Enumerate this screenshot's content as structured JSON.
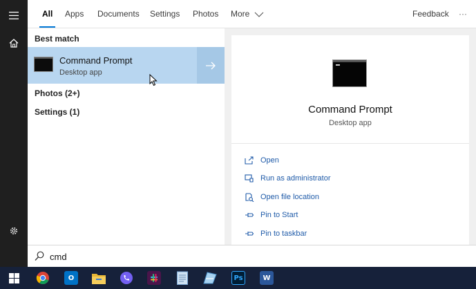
{
  "tabs": [
    {
      "label": "All",
      "active": true
    },
    {
      "label": "Apps"
    },
    {
      "label": "Documents"
    },
    {
      "label": "Settings"
    },
    {
      "label": "Photos"
    },
    {
      "label": "More"
    }
  ],
  "header": {
    "feedback": "Feedback",
    "more_dots": "···"
  },
  "results": {
    "best_match_header": "Best match",
    "best_match": {
      "title": "Command Prompt",
      "subtitle": "Desktop app"
    },
    "groups": [
      {
        "label": "Photos (2+)"
      },
      {
        "label": "Settings (1)"
      }
    ]
  },
  "preview": {
    "title": "Command Prompt",
    "subtitle": "Desktop app",
    "actions": [
      {
        "label": "Open",
        "icon": "open-icon"
      },
      {
        "label": "Run as administrator",
        "icon": "shield-icon"
      },
      {
        "label": "Open file location",
        "icon": "file-location-icon"
      },
      {
        "label": "Pin to Start",
        "icon": "pin-icon"
      },
      {
        "label": "Pin to taskbar",
        "icon": "pin-icon"
      }
    ]
  },
  "search": {
    "value": "cmd"
  },
  "taskbar": {
    "apps": [
      {
        "name": "chrome",
        "color": "#4285f4"
      },
      {
        "name": "outlook",
        "color": "#0072c6",
        "letter": "O"
      },
      {
        "name": "file-explorer",
        "color": "#f2c34a"
      },
      {
        "name": "viber",
        "color": "#7360f2"
      },
      {
        "name": "slack",
        "color": "#4a154b"
      },
      {
        "name": "notepad",
        "color": "#9fc5e8"
      },
      {
        "name": "maps",
        "color": "#6fb4e8"
      },
      {
        "name": "photoshop",
        "color": "#001e36",
        "letter": "Ps"
      },
      {
        "name": "word",
        "color": "#2b579a",
        "letter": "W"
      }
    ]
  }
}
